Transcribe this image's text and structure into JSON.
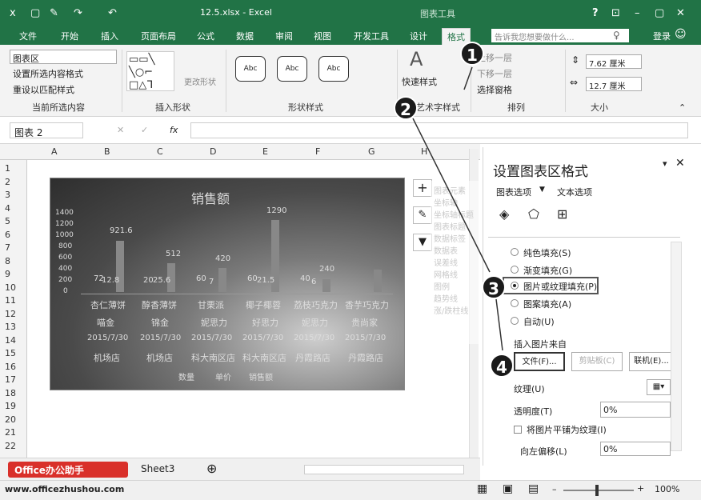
{
  "window": {
    "title": "12.5.xlsx - Excel",
    "context_tab": "图表工具",
    "help": "?",
    "login": "登录"
  },
  "ribbon_tabs": [
    "文件",
    "开始",
    "插入",
    "页面布局",
    "公式",
    "数据",
    "审阅",
    "视图",
    "开发工具",
    "设计",
    "格式"
  ],
  "tell_me": "告诉我您想要做什么...",
  "ribbon": {
    "selection_dropdown": "图表区",
    "format_selection": "设置所选内容格式",
    "reset_match": "重设以匹配样式",
    "group_current": "当前所选内容",
    "change_shape": "更改形状",
    "group_insert_shape": "插入形状",
    "style_button": "Abc",
    "group_shape_styles": "形状样式",
    "quick_styles": "快速样式",
    "group_art": "艺术字样式",
    "bring_forward": "上移一层",
    "send_backward": "下移一层",
    "selection_pane": "选择窗格",
    "group_arrange": "排列",
    "height": "7.62 厘米",
    "width": "12.7 厘米",
    "group_size": "大小"
  },
  "formula_bar": {
    "name_box": "图表 2",
    "fx": "fx"
  },
  "columns": [
    "A",
    "B",
    "C",
    "D",
    "E",
    "F",
    "G",
    "H"
  ],
  "rows": [
    "1",
    "2",
    "3",
    "4",
    "5",
    "6",
    "7",
    "8",
    "9",
    "10",
    "11",
    "12",
    "13",
    "14",
    "15",
    "16",
    "17",
    "18",
    "19",
    "20",
    "21",
    "22"
  ],
  "chart": {
    "title": "销售额",
    "axis_ticks": [
      "1400",
      "1200",
      "1000",
      "800",
      "600",
      "400",
      "200",
      "0"
    ],
    "products": [
      "杏仁薄饼",
      "醇香薄饼",
      "甘栗派",
      "椰子椰蓉",
      "荔枝巧克力",
      "香芋巧克力"
    ],
    "brands": [
      "喵金",
      "锦金",
      "妮思力",
      "好思力",
      "妮思力",
      "贵尚家"
    ],
    "dates": [
      "2015/7/30",
      "2015/7/30",
      "2015/7/30",
      "2015/7/30",
      "2015/7/30",
      "2015/7/30"
    ],
    "stores": [
      "机场店",
      "机场店",
      "科大南区店",
      "科大南区店",
      "丹霞路店",
      "丹霞路店"
    ],
    "values": [
      "921.6",
      "512",
      "420",
      "1290",
      "240",
      ""
    ],
    "qty_labels": [
      "72",
      "20",
      "60",
      "60",
      "40",
      ""
    ],
    "price_labels": [
      "12.8",
      "25.6",
      "7",
      "21.5",
      "6",
      ""
    ],
    "legend": [
      "数量",
      "单价",
      "销售额"
    ]
  },
  "chart_elements": {
    "header": "图表元素",
    "items": [
      "坐标轴",
      "坐标轴标题",
      "图表标题",
      "数据标签",
      "数据表",
      "误差线",
      "网格线",
      "图例",
      "趋势线",
      "涨/跌柱线"
    ]
  },
  "pane": {
    "title": "设置图表区格式",
    "tabs": [
      "图表选项",
      "文本选项"
    ],
    "fill_options": [
      "纯色填充(S)",
      "渐变填充(G)",
      "图片或纹理填充(P)",
      "图案填充(A)",
      "自动(U)"
    ],
    "insert_from": "插入图片来自",
    "btn_file": "文件(F)...",
    "btn_clipboard": "剪贴板(C)",
    "btn_online": "联机(E)...",
    "texture": "纹理(U)",
    "transparency": "透明度(T)",
    "transparency_val": "0%",
    "tile": "将图片平铺为纹理(I)",
    "offset_left": "向左偏移(L)",
    "offset_val": "0%"
  },
  "badges": [
    "1",
    "2",
    "3",
    "4"
  ],
  "sheet_tab": "Sheet3",
  "watermark": {
    "logo": "Office办公助手",
    "url": "www.officezhushou.com"
  },
  "zoom": "100%"
}
